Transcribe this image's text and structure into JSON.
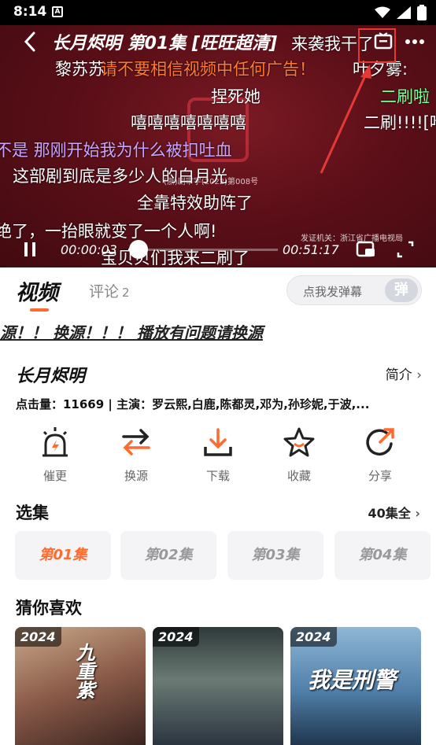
{
  "status": {
    "time": "8:14",
    "notif_icon": "A"
  },
  "player": {
    "title": "长月烬明 第01集 [旺旺超清]",
    "certificate_number": "(浙)剧审字(2022)第008号",
    "issuer": "发证机关：浙江省广播电视局",
    "current_time": "00:00:03",
    "duration": "00:51:17",
    "progress": 0.001,
    "danmaku": [
      {
        "text": "来袭我干了",
        "color": "white"
      },
      {
        "text": "黎苏苏",
        "color": "white"
      },
      {
        "text": "请不要相信视频中任何广告！",
        "color": "orange"
      },
      {
        "text": "叶夕雾:",
        "color": "white"
      },
      {
        "text": "捏死她",
        "color": "white"
      },
      {
        "text": "二刷啦",
        "color": "green"
      },
      {
        "text": "嘻嘻嘻嘻嘻嘻嘻",
        "color": "white"
      },
      {
        "text": "二刷!!!![哈",
        "color": "white"
      },
      {
        "text": "不是 那刚开始我为什么被扣吐血",
        "color": "purple"
      },
      {
        "text": "这部剧到底是多少人的白月光",
        "color": "white"
      },
      {
        "text": "全靠特效助阵了",
        "color": "white"
      },
      {
        "text": "绝了，一抬眼就变了一个人啊!",
        "color": "white"
      },
      {
        "text": "宝贝贝们我来二刷了",
        "color": "white"
      }
    ]
  },
  "tabs": {
    "video": "视频",
    "comments": "评论",
    "comment_count": "2",
    "danmaku_button": "点我发弹幕",
    "danmaku_icon": "弹"
  },
  "notice": "源！！ 换源！！！ 播放有问题请换源",
  "info": {
    "series_title": "长月烬明",
    "intro_label": "简介",
    "meta": "点击量：11669 | 主演：罗云熙,白鹿,陈都灵,邓为,孙珍妮,于波,..."
  },
  "actions": [
    {
      "label": "催更",
      "icon": "alarm-icon"
    },
    {
      "label": "换源",
      "icon": "swap-icon"
    },
    {
      "label": "下载",
      "icon": "download-icon"
    },
    {
      "label": "收藏",
      "icon": "star-icon"
    },
    {
      "label": "分享",
      "icon": "share-icon"
    }
  ],
  "episodes": {
    "section_title": "选集",
    "total": "40集全",
    "items": [
      "第01集",
      "第02集",
      "第03集",
      "第04集"
    ],
    "active_index": 0
  },
  "recommend": {
    "section_title": "猜你喜欢",
    "items": [
      {
        "year": "2024",
        "title": "九重紫"
      },
      {
        "year": "2024",
        "title": ""
      },
      {
        "year": "2024",
        "title": "我是刑警"
      }
    ]
  },
  "colors": {
    "accent": "#ff6a2e",
    "player_bg": "#5c0f18",
    "annotation_red": "#e53935"
  }
}
